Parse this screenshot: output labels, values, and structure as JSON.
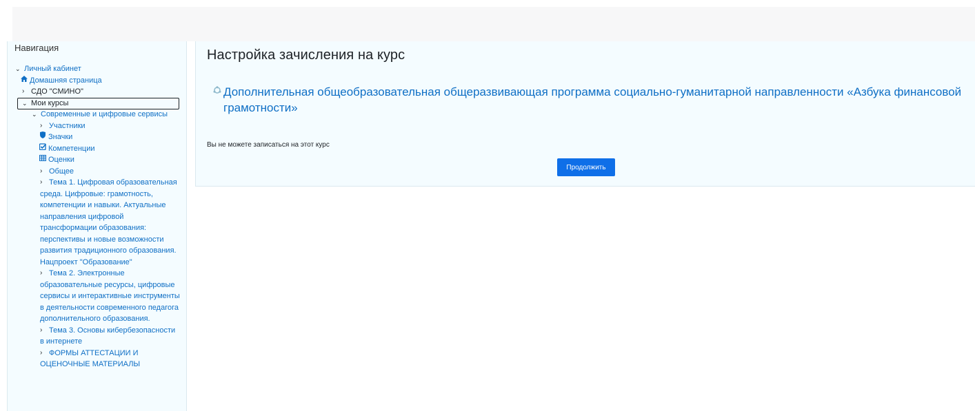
{
  "navigation": {
    "title": "Навигация",
    "items": [
      {
        "label": "Личный кабинет",
        "chevron": "down",
        "icon": ""
      },
      {
        "label": "Домашняя страница",
        "chevron": "",
        "icon": "home-icon"
      },
      {
        "label": "СДО \"СМИНО\"",
        "chevron": "right",
        "icon": ""
      },
      {
        "label": "Мои курсы",
        "chevron": "down",
        "icon": ""
      },
      {
        "label": "Современные и цифровые сервисы",
        "chevron": "down",
        "icon": ""
      },
      {
        "label": "Участники",
        "chevron": "right",
        "icon": ""
      },
      {
        "label": "Значки",
        "chevron": "",
        "icon": "shield-icon"
      },
      {
        "label": "Компетенции",
        "chevron": "",
        "icon": "checkbox-icon"
      },
      {
        "label": "Оценки",
        "chevron": "",
        "icon": "table-icon"
      },
      {
        "label": "Общее",
        "chevron": "right",
        "icon": ""
      },
      {
        "label": "Тема 1. Цифровая образовательная среда. Цифровые: грамотность, компетенции и навыки. Актуальные направления цифровой трансформации образования: перспективы и новые возможности развития традиционного образования. Нацпроект \"Образование\"",
        "chevron": "right",
        "icon": ""
      },
      {
        "label": "Тема 2. Электронные образовательные ресурсы, цифровые сервисы и интерактивные инструменты в деятельности современного педагога дополнительного образования.",
        "chevron": "right",
        "icon": ""
      },
      {
        "label": "Тема 3. Основы кибербезопасности в интернете",
        "chevron": "right",
        "icon": ""
      },
      {
        "label": "ФОРМЫ АТТЕСТАЦИИ И ОЦЕНОЧНЫЕ МАТЕРИАЛЫ",
        "chevron": "right",
        "icon": ""
      }
    ]
  },
  "main": {
    "page_title": "Настройка зачисления на курс",
    "course_link": "Дополнительная общеобразовательная общеразвивающая программа социально-гуманитарной направленности «Азбука финансовой грамотности»",
    "notice": "Вы не можете записаться на этот курс",
    "continue_button": "Продолжить"
  },
  "colors": {
    "accent": "#0f6fe8",
    "link": "#0f6fc5",
    "panel_bg": "#f4fcff"
  }
}
